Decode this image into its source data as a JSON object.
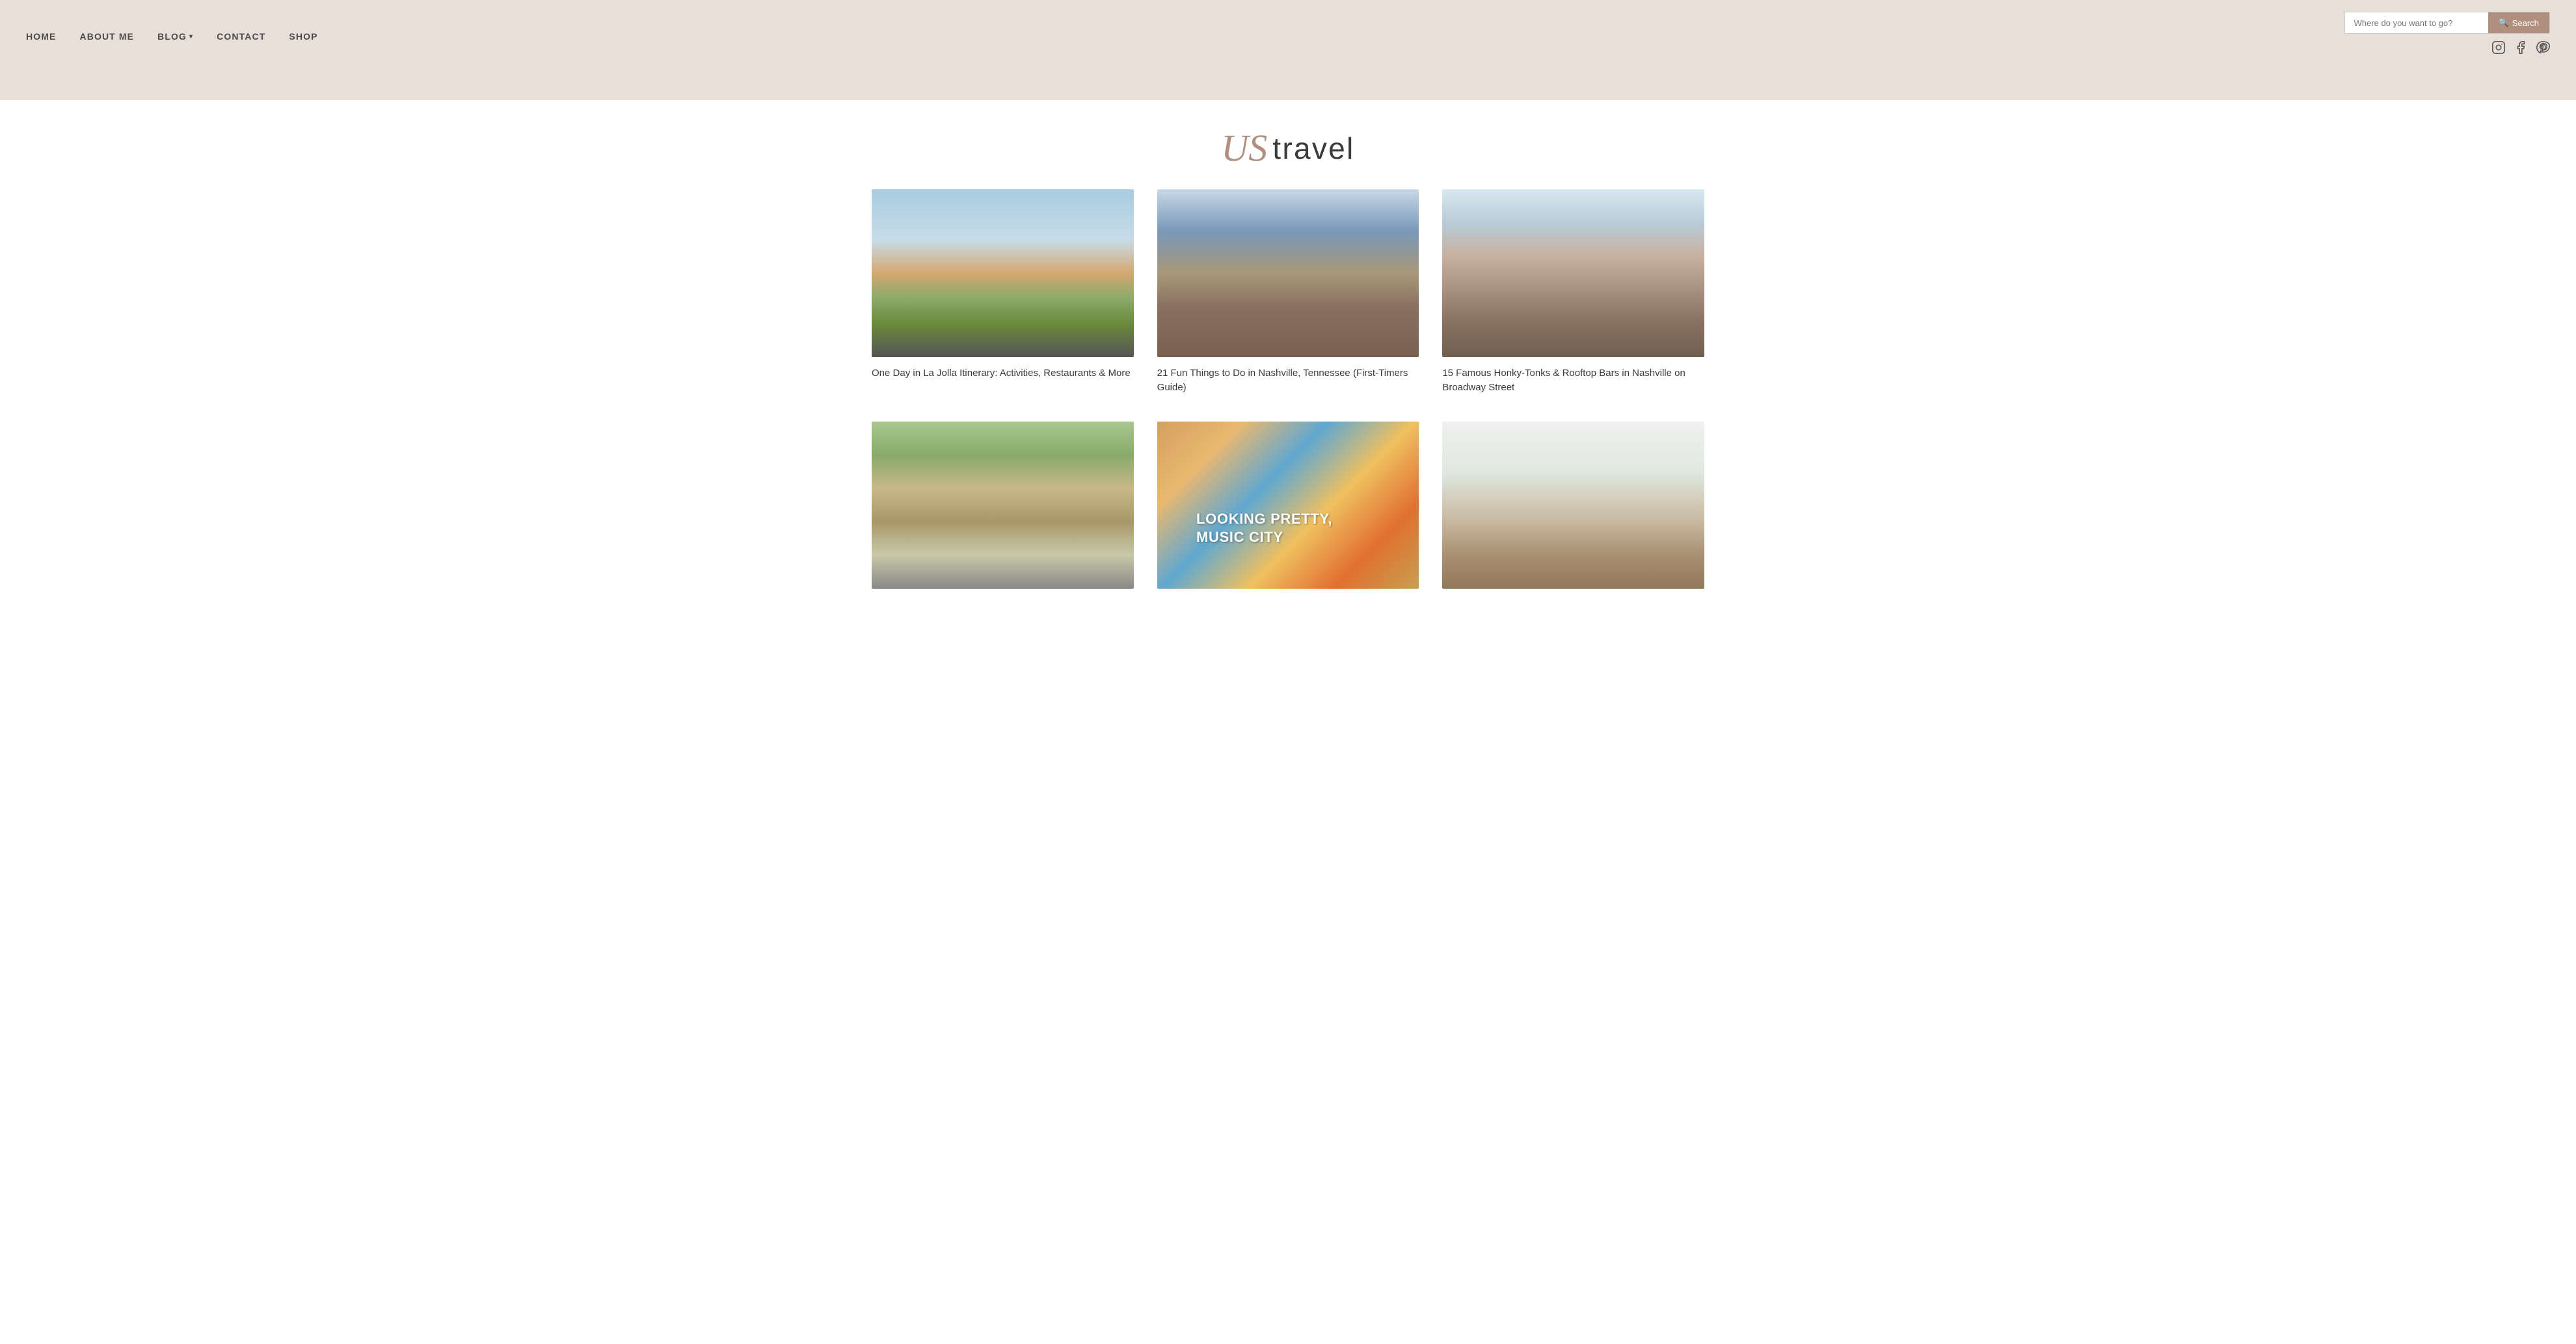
{
  "header": {
    "nav": {
      "home_label": "HOME",
      "about_label": "ABOUT ME",
      "blog_label": "BLOG",
      "contact_label": "CONTACT",
      "shop_label": "SHOP"
    },
    "search": {
      "placeholder": "Where do you want to go?",
      "button_label": "Search"
    },
    "social": {
      "instagram_label": "Instagram",
      "facebook_label": "Facebook",
      "pinterest_label": "Pinterest"
    }
  },
  "page": {
    "title_us": "US",
    "title_travel": "travel"
  },
  "cards": [
    {
      "id": "la-jolla",
      "title": "One Day in La Jolla Itinerary: Activities, Restaurants & More",
      "image_class": "img-la-jolla"
    },
    {
      "id": "nashville-fun",
      "title": "21 Fun Things to Do in Nashville, Tennessee (First-Timers Guide)",
      "image_class": "img-nashville-fun"
    },
    {
      "id": "honkytonk",
      "title": "15 Famous Honky-Tonks & Rooftop Bars in Nashville on Broadway Street",
      "image_class": "img-honkytonk"
    },
    {
      "id": "parthenon",
      "title": "",
      "image_class": "img-parthenon"
    },
    {
      "id": "mural",
      "title": "",
      "image_class": "img-mural"
    },
    {
      "id": "coffee",
      "title": "",
      "image_class": "img-coffee"
    }
  ]
}
